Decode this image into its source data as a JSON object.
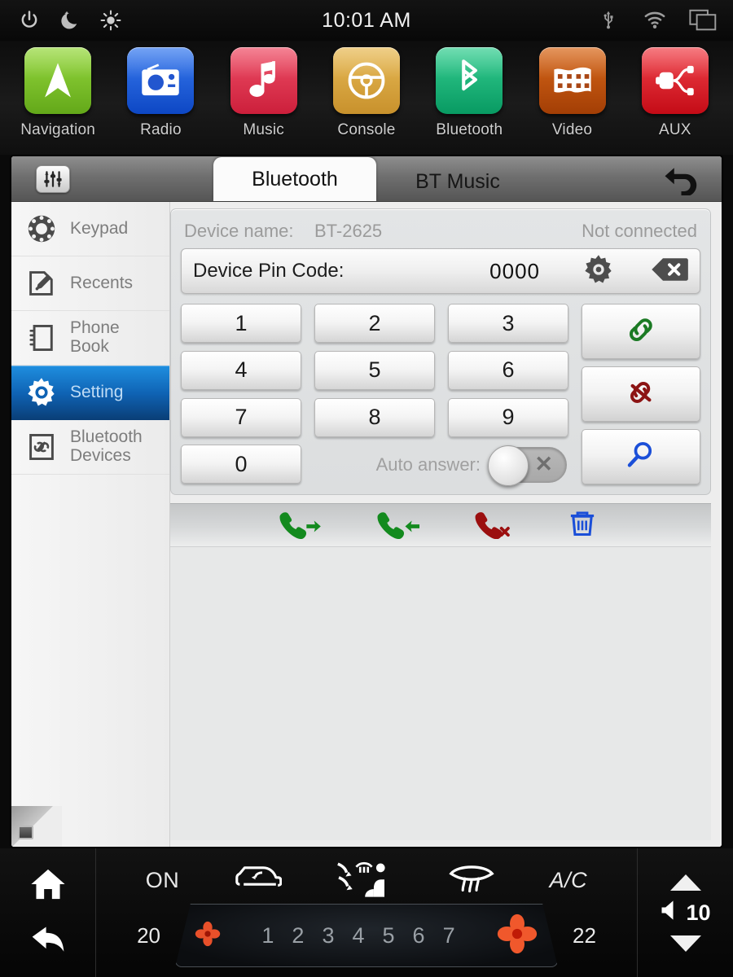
{
  "statusbar": {
    "clock": "10:01 AM",
    "left_icons": [
      {
        "name": "power-icon"
      },
      {
        "name": "night-mode-icon"
      },
      {
        "name": "brightness-icon"
      }
    ],
    "right_icons": [
      {
        "name": "usb-icon"
      },
      {
        "name": "wifi-icon"
      },
      {
        "name": "multi-window-icon"
      }
    ]
  },
  "launcher": {
    "apps": [
      {
        "label": "Navigation",
        "icon": "navigation-arrow-icon",
        "color": "#7fc42b"
      },
      {
        "label": "Radio",
        "icon": "radio-icon",
        "color": "#1a5fe0"
      },
      {
        "label": "Music",
        "icon": "music-note-icon",
        "color": "#e0374f"
      },
      {
        "label": "Console",
        "icon": "steering-wheel-icon",
        "color": "#d8a83c"
      },
      {
        "label": "Bluetooth",
        "icon": "bluetooth-icon",
        "color": "#17b97a"
      },
      {
        "label": "Video",
        "icon": "film-strip-icon",
        "color": "#c1520e"
      },
      {
        "label": "AUX",
        "icon": "aux-plug-icon",
        "color": "#e01f28"
      }
    ]
  },
  "window": {
    "eq_button": "equalizer-icon",
    "back_button": "back-arrow-icon",
    "tabs": [
      {
        "label": "Bluetooth",
        "active": true
      },
      {
        "label": "BT Music",
        "active": false
      }
    ]
  },
  "sidebar": {
    "items": [
      {
        "label": "Keypad",
        "icon": "rotary-dial-icon",
        "active": false
      },
      {
        "label": "Recents",
        "icon": "note-pencil-icon",
        "active": false
      },
      {
        "label": "Phone\nBook",
        "icon": "phone-book-icon",
        "active": false
      },
      {
        "label": "Setting",
        "icon": "gear-icon",
        "active": true
      },
      {
        "label": "Bluetooth\nDevices",
        "icon": "chain-link-icon",
        "active": false
      }
    ]
  },
  "device": {
    "name_label": "Device name:",
    "name_value": "BT-2625",
    "status": "Not connected"
  },
  "pin": {
    "label": "Device Pin Code:",
    "value": "0000",
    "gear_icon": "gear-icon",
    "backspace_icon": "backspace-icon"
  },
  "keypad": {
    "keys": [
      "1",
      "2",
      "3",
      "4",
      "5",
      "6",
      "7",
      "8",
      "9",
      "0"
    ],
    "auto_answer_label": "Auto answer:",
    "auto_answer_on": false,
    "auto_answer_off_symbol": "✕"
  },
  "actions": [
    {
      "name": "connect-button",
      "icon": "link-icon",
      "color": "#1b7a24"
    },
    {
      "name": "disconnect-button",
      "icon": "broken-link-icon",
      "color": "#8c1414"
    },
    {
      "name": "search-button",
      "icon": "magnifier-icon",
      "color": "#1b4fd8"
    }
  ],
  "call_toolbar": [
    {
      "name": "outgoing-call-button",
      "icon": "phone-outgoing-icon",
      "color": "#138a1e"
    },
    {
      "name": "incoming-call-button",
      "icon": "phone-incoming-icon",
      "color": "#138a1e"
    },
    {
      "name": "end-call-button",
      "icon": "phone-end-icon",
      "color": "#9b0f0f"
    },
    {
      "name": "delete-button",
      "icon": "trash-icon",
      "color": "#1b4fd8"
    }
  ],
  "climate": {
    "home_icon": "home-icon",
    "back_icon": "back-arrow-icon",
    "on_label": "ON",
    "recirculate_icon": "air-recirculate-icon",
    "airflow_icon": "airflow-body-icon",
    "defrost_icon": "rear-defrost-icon",
    "ac_label": "A/C",
    "temp_left": "20",
    "temp_right": "22",
    "fan_levels": [
      "1",
      "2",
      "3",
      "4",
      "5",
      "6",
      "7"
    ],
    "fan_icon_small": "fan-icon",
    "fan_icon_large": "fan-icon",
    "volume_value": "10",
    "volume_up_icon": "triangle-up-icon",
    "volume_down_icon": "triangle-down-icon",
    "speaker_icon": "speaker-icon"
  }
}
